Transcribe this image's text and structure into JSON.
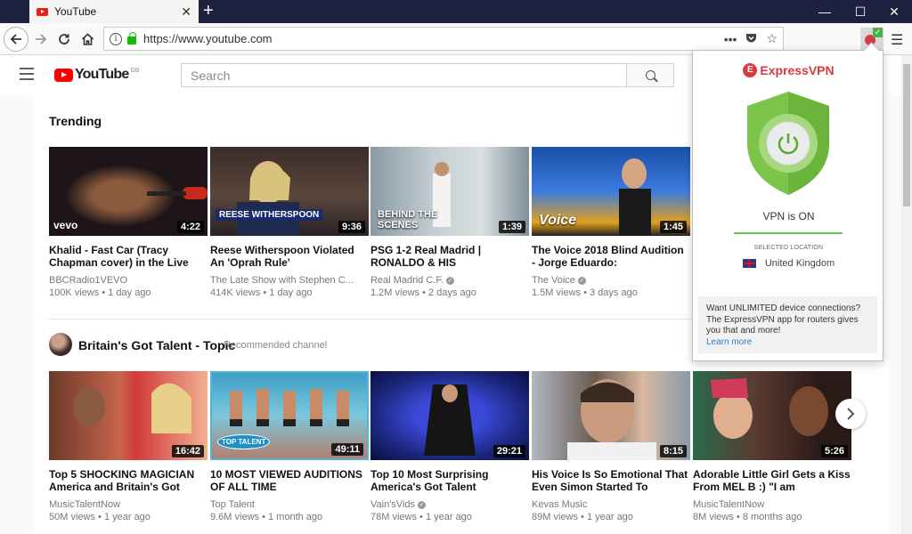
{
  "browser": {
    "tab_title": "YouTube",
    "new_tab": "+",
    "url": "https://www.youtube.com",
    "close_glyph": "✕",
    "window_controls": {
      "minimize": "—",
      "maximize": "☐",
      "close": "✕"
    }
  },
  "youtube": {
    "logo_text": "YouTube",
    "country_code": "GB",
    "search_placeholder": "Search",
    "trending": {
      "title": "Trending",
      "videos": [
        {
          "title": "Khalid - Fast Car (Tracy Chapman cover) in the Live",
          "channel": "BBCRadio1VEVO",
          "verified": false,
          "views": "100K views",
          "age": "1 day ago",
          "duration": "4:22",
          "badge": "vevo"
        },
        {
          "title": "Reese Witherspoon Violated An 'Oprah Rule'",
          "channel": "The Late Show with Stephen C...",
          "verified": false,
          "views": "414K views",
          "age": "1 day ago",
          "duration": "9:36",
          "badge": "REESE WITHERSPOON"
        },
        {
          "title": "PSG 1-2 Real Madrid | RONALDO & HIS",
          "channel": "Real Madrid C.F.",
          "verified": true,
          "views": "1.2M views",
          "age": "2 days ago",
          "duration": "1:39",
          "badge": "BEHIND THE SCENES"
        },
        {
          "title": "The Voice 2018 Blind Audition - Jorge Eduardo:",
          "channel": "The Voice",
          "verified": true,
          "views": "1.5M views",
          "age": "3 days ago",
          "duration": "1:45",
          "badge": "Voice"
        }
      ]
    },
    "channel_shelf": {
      "title": "Britain's Got Talent - Topic",
      "subtitle": "Recommended channel",
      "videos": [
        {
          "title": "Top 5 SHOCKING MAGICIAN America and Britain's Got",
          "channel": "MusicTalentNow",
          "verified": false,
          "views": "50M views",
          "age": "1 year ago",
          "duration": "16:42"
        },
        {
          "title": "10 MOST VIEWED AUDITIONS OF ALL TIME",
          "channel": "Top Talent",
          "verified": false,
          "views": "9.6M views",
          "age": "1 month ago",
          "duration": "49:11",
          "badge": "TOP TALENT"
        },
        {
          "title": "Top 10 Most Surprising America's Got Talent",
          "channel": "Vain'sVids",
          "verified": true,
          "views": "78M views",
          "age": "1 year ago",
          "duration": "29:21"
        },
        {
          "title": "His Voice Is So Emotional That Even Simon Started To",
          "channel": "Kevas Music",
          "verified": false,
          "views": "89M views",
          "age": "1 year ago",
          "duration": "8:15"
        },
        {
          "title": "Adorable Little Girl Gets a Kiss From MEL B :) \"I am",
          "channel": "MusicTalentNow",
          "verified": false,
          "views": "8M views",
          "age": "8 months ago",
          "duration": "5:26"
        }
      ]
    }
  },
  "vpn": {
    "brand": "ExpressVPN",
    "status": "VPN is ON",
    "selected_label": "SELECTED LOCATION",
    "location": "United Kingdom",
    "promo_text": "Want UNLIMITED device connections? The ExpressVPN app for routers gives you that and more!",
    "learn_more": "Learn more",
    "shield_color": "#7cc54a"
  },
  "colors": {
    "yt_red": "#ff0000",
    "vpn_red": "#da3940",
    "vpn_green": "#6bc24a",
    "tab_strip": "#1e2240"
  }
}
